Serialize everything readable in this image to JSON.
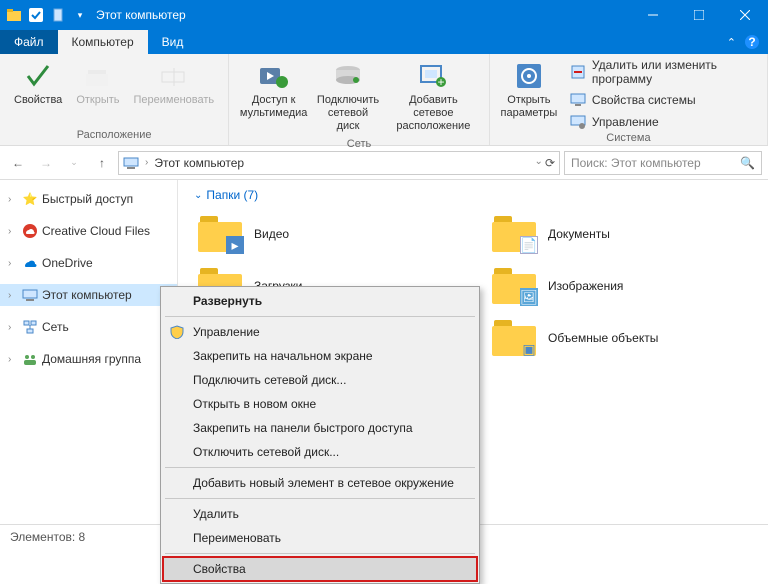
{
  "window": {
    "title": "Этот компьютер"
  },
  "menubar": {
    "file": "Файл",
    "computer": "Компьютер",
    "view": "Вид"
  },
  "ribbon": {
    "group_location": {
      "label": "Расположение",
      "properties": "Свойства",
      "open": "Открыть",
      "rename": "Переименовать"
    },
    "group_network": {
      "label": "Сеть",
      "media_access": "Доступ к\nмультимедиа",
      "map_drive": "Подключить\nсетевой диск",
      "add_location": "Добавить сетевое\nрасположение"
    },
    "group_system": {
      "label": "Система",
      "open_settings": "Открыть\nпараметры",
      "uninstall": "Удалить или изменить программу",
      "sys_props": "Свойства системы",
      "manage": "Управление"
    }
  },
  "address": {
    "crumb": "Этот компьютер"
  },
  "search": {
    "placeholder": "Поиск: Этот компьютер"
  },
  "sidebar": {
    "quick_access": "Быстрый доступ",
    "creative_cloud": "Creative Cloud Files",
    "onedrive": "OneDrive",
    "this_pc": "Этот компьютер",
    "network": "Сеть",
    "homegroup": "Домашняя группа"
  },
  "content": {
    "section": "Папки (7)",
    "folders": {
      "video": "Видео",
      "documents": "Документы",
      "downloads": "Загрузки",
      "pictures": "Изображения",
      "objects3d": "Объемные объекты"
    }
  },
  "context_menu": {
    "expand": "Развернуть",
    "manage": "Управление",
    "pin_start": "Закрепить на начальном экране",
    "map_drive": "Подключить сетевой диск...",
    "new_window": "Открыть в новом окне",
    "pin_quick": "Закрепить на панели быстрого доступа",
    "disconnect_drive": "Отключить сетевой диск...",
    "add_net_location": "Добавить новый элемент в сетевое окружение",
    "delete": "Удалить",
    "rename": "Переименовать",
    "properties": "Свойства"
  },
  "statusbar": {
    "elements": "Элементов: 8"
  },
  "colors": {
    "accent": "#0078d7"
  }
}
